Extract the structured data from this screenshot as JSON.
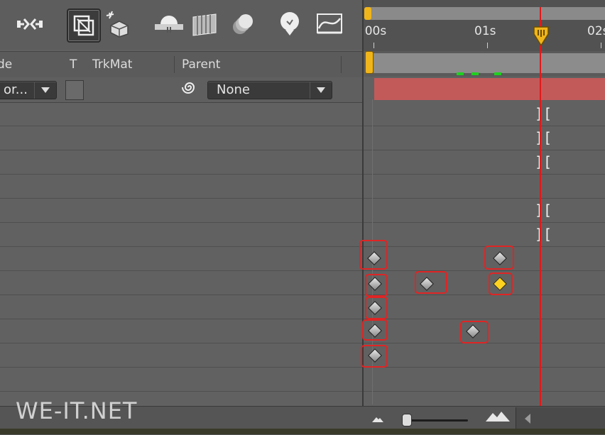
{
  "toolbar": {
    "tools": [
      {
        "icon": "graph-editor-icon",
        "active": false
      },
      {
        "icon": "frame-blending-icon",
        "active": true
      },
      {
        "icon": "draft-3d-icon",
        "active": false
      },
      {
        "icon": "shy-layers-icon",
        "active": false
      },
      {
        "icon": "frame-blend-icon",
        "active": false
      },
      {
        "icon": "motion-blur-icon",
        "active": false
      },
      {
        "icon": "brainstorm-icon",
        "active": false
      },
      {
        "icon": "graph-icon",
        "active": false
      }
    ]
  },
  "ruler": {
    "labels": [
      ":00s",
      "01s",
      "02s"
    ]
  },
  "columns": {
    "mode": "de",
    "t": "T",
    "trkmat": "TrkMat",
    "parent": "Parent"
  },
  "layer": {
    "mode_value": "or...",
    "parent_value": "None"
  },
  "watermark": "WE-IT.NET",
  "colors": {
    "playhead": "#e01a1a",
    "layer_bar": "#c25a5a",
    "keyframe_selected": "#ffd21f",
    "highlight_box": "#e02424"
  }
}
